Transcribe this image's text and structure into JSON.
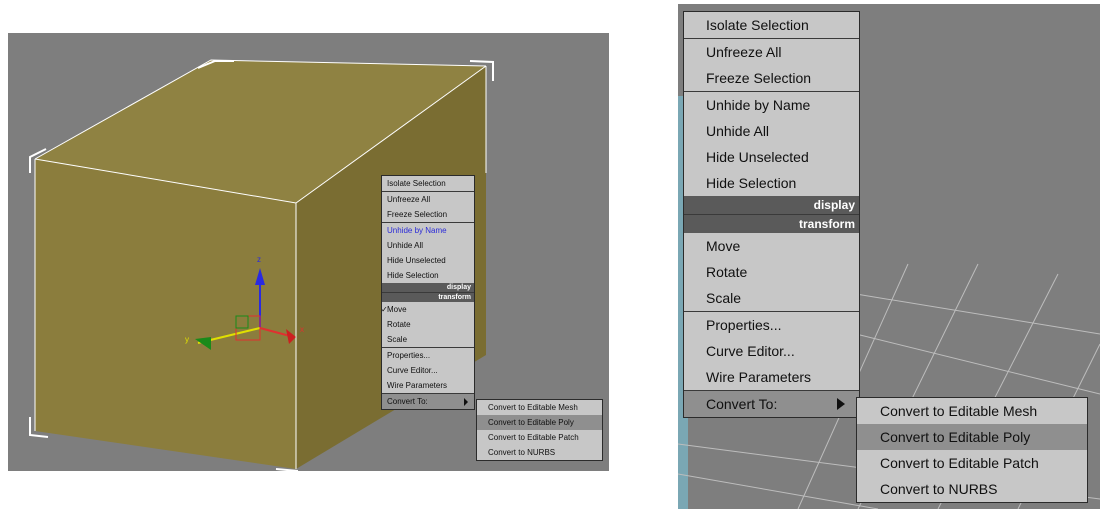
{
  "context_menu": {
    "display_items": [
      "Isolate Selection",
      "Unfreeze All",
      "Freeze Selection",
      "Unhide by Name",
      "Unhide All",
      "Hide Unselected",
      "Hide Selection"
    ],
    "display_header": "display",
    "transform_header": "transform",
    "transform_items": [
      "Move",
      "Rotate",
      "Scale",
      "Properties...",
      "Curve Editor...",
      "Wire Parameters"
    ],
    "convert_to": "Convert To:"
  },
  "submenu": {
    "items": [
      "Convert to Editable Mesh",
      "Convert to Editable Poly",
      "Convert to Editable Patch",
      "Convert to NURBS"
    ]
  },
  "gizmo": {
    "x_label": "x",
    "y_label": "y",
    "z_label": "z"
  },
  "colors": {
    "box": "#8b7d3d",
    "viewport": "#7e7e7e",
    "menu": "#c7c7c7",
    "header": "#5a5a5a",
    "highlight": "#8f8f8f",
    "hover_text": "#2a2ad8"
  }
}
